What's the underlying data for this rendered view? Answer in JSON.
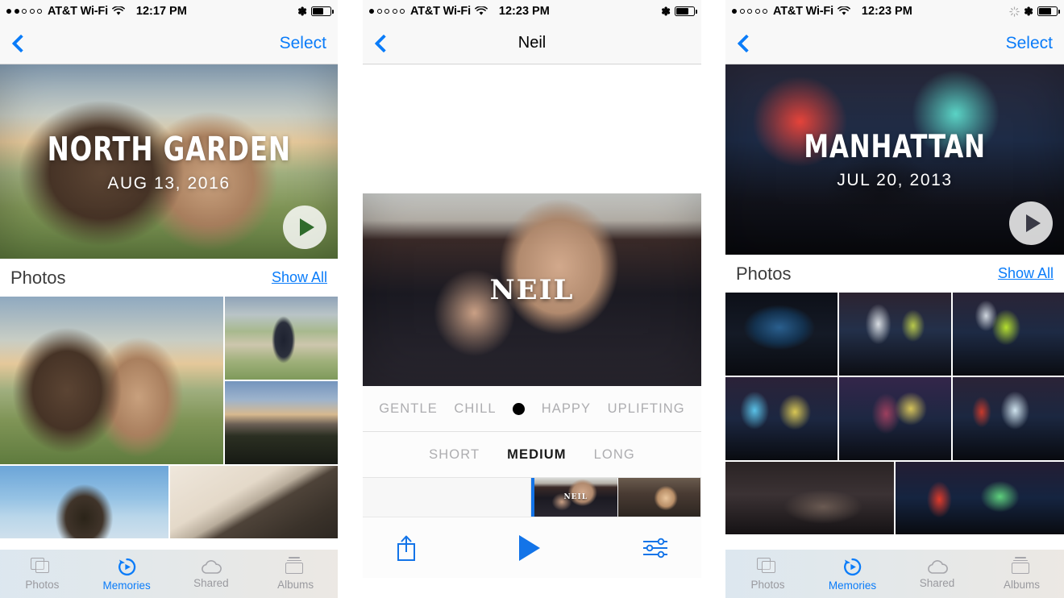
{
  "panels": [
    {
      "id": "memory-north-garden",
      "status_bar": {
        "signal_dots": [
          true,
          true,
          false,
          false,
          false
        ],
        "carrier": "AT&T Wi-Fi",
        "wifi_icon": "wifi-icon",
        "time": "12:17 PM",
        "bluetooth_icon": "bluetooth-icon",
        "battery_level": 62,
        "spinner": false
      },
      "nav": {
        "back_icon": "back-chevron-icon",
        "title": "",
        "action_label": "Select"
      },
      "hero": {
        "title": "NORTH GARDEN",
        "date": "AUG 13, 2016",
        "play_label": "play-icon"
      },
      "section": {
        "title": "Photos",
        "show_all": "Show All"
      },
      "tabs": [
        {
          "label": "Photos",
          "icon": "photos-stack-icon",
          "active": false
        },
        {
          "label": "Memories",
          "icon": "memories-icon",
          "active": true
        },
        {
          "label": "Shared",
          "icon": "cloud-icon",
          "active": false
        },
        {
          "label": "Albums",
          "icon": "albums-icon",
          "active": false
        }
      ]
    },
    {
      "id": "memory-editor-neil",
      "status_bar": {
        "signal_dots": [
          true,
          false,
          false,
          false,
          false
        ],
        "carrier": "AT&T Wi-Fi",
        "wifi_icon": "wifi-icon",
        "time": "12:23 PM",
        "bluetooth_icon": "bluetooth-icon",
        "battery_level": 72,
        "spinner": false
      },
      "nav": {
        "back_icon": "back-chevron-icon",
        "title": "Neil",
        "action_label": ""
      },
      "hero": {
        "title": "NEIL"
      },
      "mood_options": [
        {
          "label": "GENTLE",
          "selected": false
        },
        {
          "label": "CHILL",
          "selected": false
        },
        {
          "label": "",
          "selected": true
        },
        {
          "label": "HAPPY",
          "selected": false
        },
        {
          "label": "UPLIFTING",
          "selected": false
        }
      ],
      "duration_options": [
        {
          "label": "SHORT",
          "selected": false
        },
        {
          "label": "MEDIUM",
          "selected": true
        },
        {
          "label": "LONG",
          "selected": false
        }
      ],
      "toolbar": {
        "share_icon": "share-icon",
        "play_icon": "play-icon",
        "adjust_icon": "adjustments-sliders-icon"
      },
      "filmstrip": {
        "frame_label": "NEIL"
      }
    },
    {
      "id": "memory-manhattan",
      "status_bar": {
        "signal_dots": [
          true,
          false,
          false,
          false,
          false
        ],
        "carrier": "AT&T Wi-Fi",
        "wifi_icon": "wifi-icon",
        "time": "12:23 PM",
        "bluetooth_icon": "bluetooth-icon",
        "battery_level": 72,
        "spinner": true
      },
      "nav": {
        "back_icon": "back-chevron-icon",
        "title": "",
        "action_label": "Select"
      },
      "hero": {
        "title": "MANHATTAN",
        "date": "JUL 20, 2013",
        "play_label": "play-icon"
      },
      "section": {
        "title": "Photos",
        "show_all": "Show All"
      },
      "tabs": [
        {
          "label": "Photos",
          "icon": "photos-stack-icon",
          "active": false
        },
        {
          "label": "Memories",
          "icon": "memories-icon",
          "active": true
        },
        {
          "label": "Shared",
          "icon": "cloud-icon",
          "active": false
        },
        {
          "label": "Albums",
          "icon": "albums-icon",
          "active": false
        }
      ]
    }
  ],
  "colors": {
    "accent_blue": "#0a7cf9",
    "editor_blue": "#1374e8",
    "nav_background": "#f8f8f8",
    "inactive_gray": "#a6a6ab",
    "selected_text": "#1a1a1a"
  }
}
